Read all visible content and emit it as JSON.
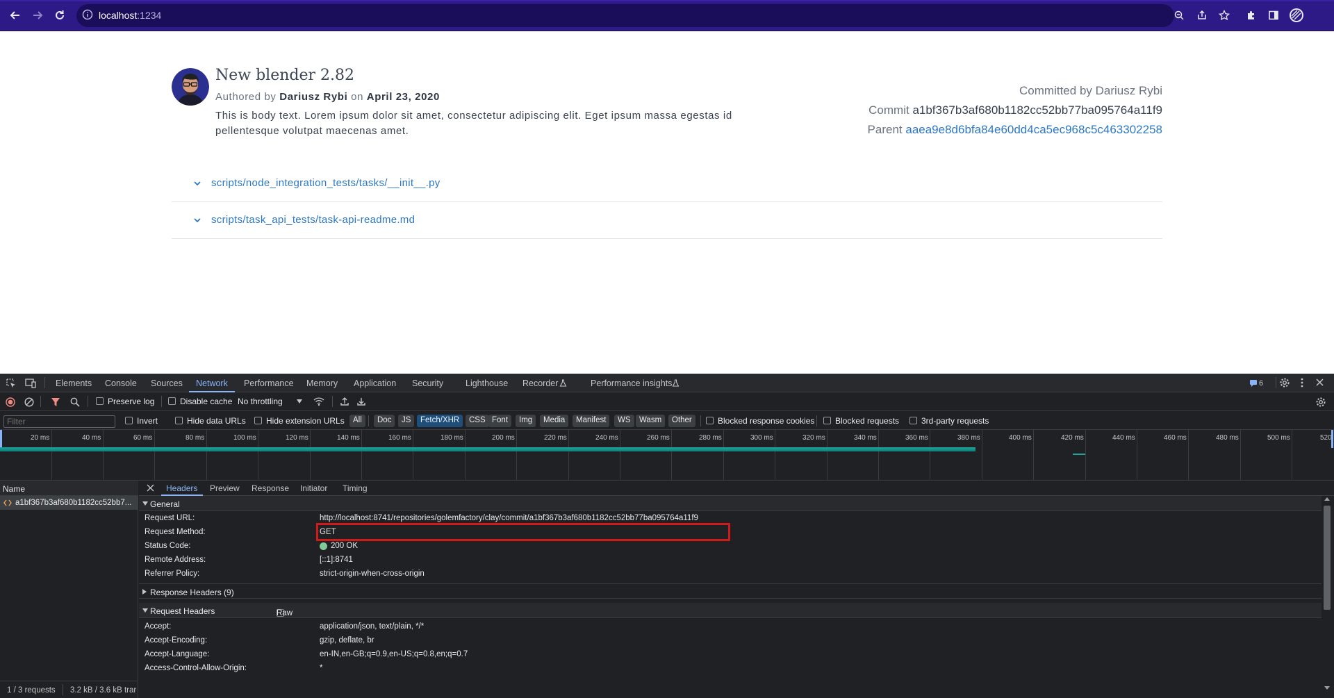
{
  "browser": {
    "url_host": "localhost",
    "url_port": ":1234"
  },
  "commit": {
    "title": "New blender 2.82",
    "authored_prefix": "Authored by",
    "author": "Dariusz Rybi",
    "on_word": "on",
    "date": "April 23, 2020",
    "body": "This is body text. Lorem ipsum dolor sit amet, consectetur adipiscing elit. Eget ipsum massa egestas id pellentesque volutpat maecenas amet.",
    "committed_by_label": "Committed by",
    "committer": "Dariusz Rybi",
    "commit_label": "Commit",
    "commit_hash": "a1bf367b3af680b1182cc52bb77ba095764a11f9",
    "parent_label": "Parent",
    "parent_hash": "aaea9e8d6bfa84e60dd4ca5ec968c5c463302258"
  },
  "files": [
    "scripts/node_integration_tests/tasks/__init__.py",
    "scripts/task_api_tests/task-api-readme.md"
  ],
  "devtools": {
    "tabs": [
      "Elements",
      "Console",
      "Sources",
      "Network",
      "Performance",
      "Memory",
      "Application",
      "Security",
      "Lighthouse",
      "Recorder",
      "Performance insights"
    ],
    "active_tab": "Network",
    "issues_count": "6",
    "toolbar": {
      "preserve_log": "Preserve log",
      "disable_cache": "Disable cache",
      "throttling": "No throttling"
    },
    "filter": {
      "placeholder": "Filter",
      "invert": "Invert",
      "hide_data_urls": "Hide data URLs",
      "hide_extension_urls": "Hide extension URLs",
      "types": [
        "All",
        "Doc",
        "JS",
        "Fetch/XHR",
        "CSS",
        "Font",
        "Img",
        "Media",
        "Manifest",
        "WS",
        "Wasm",
        "Other"
      ],
      "active_type": "Fetch/XHR",
      "blocked_response_cookies": "Blocked response cookies",
      "blocked_requests": "Blocked requests",
      "third_party": "3rd-party requests"
    },
    "timeline_ticks": [
      "20 ms",
      "40 ms",
      "60 ms",
      "80 ms",
      "100 ms",
      "120 ms",
      "140 ms",
      "160 ms",
      "180 ms",
      "200 ms",
      "220 ms",
      "240 ms",
      "260 ms",
      "280 ms",
      "300 ms",
      "320 ms",
      "340 ms",
      "360 ms",
      "380 ms",
      "400 ms",
      "420 ms",
      "440 ms",
      "460 ms",
      "480 ms",
      "500 ms",
      "520"
    ],
    "name_header": "Name",
    "request_name": "a1bf367b3af680b1182cc52bb7...",
    "status_requests": "1 / 3 requests",
    "status_transferred": "3.2 kB / 3.6 kB trar",
    "detail_tabs": [
      "Headers",
      "Preview",
      "Response",
      "Initiator",
      "Timing"
    ],
    "active_detail_tab": "Headers",
    "general_label": "General",
    "general": [
      {
        "key": "Request URL:",
        "value": "http://localhost:8741/repositories/golemfactory/clay/commit/a1bf367b3af680b1182cc52bb77ba095764a11f9"
      },
      {
        "key": "Request Method:",
        "value": "GET"
      },
      {
        "key": "Status Code:",
        "value": "200 OK"
      },
      {
        "key": "Remote Address:",
        "value": "[::1]:8741"
      },
      {
        "key": "Referrer Policy:",
        "value": "strict-origin-when-cross-origin"
      }
    ],
    "response_headers_label": "Response Headers (9)",
    "request_headers_label": "Request Headers",
    "raw_label": "Raw",
    "request_headers": [
      {
        "key": "Accept:",
        "value": "application/json, text/plain, */*"
      },
      {
        "key": "Accept-Encoding:",
        "value": "gzip, deflate, br"
      },
      {
        "key": "Accept-Language:",
        "value": "en-IN,en-GB;q=0.9,en-US;q=0.8,en;q=0.7"
      },
      {
        "key": "Access-Control-Allow-Origin:",
        "value": "*"
      }
    ]
  }
}
